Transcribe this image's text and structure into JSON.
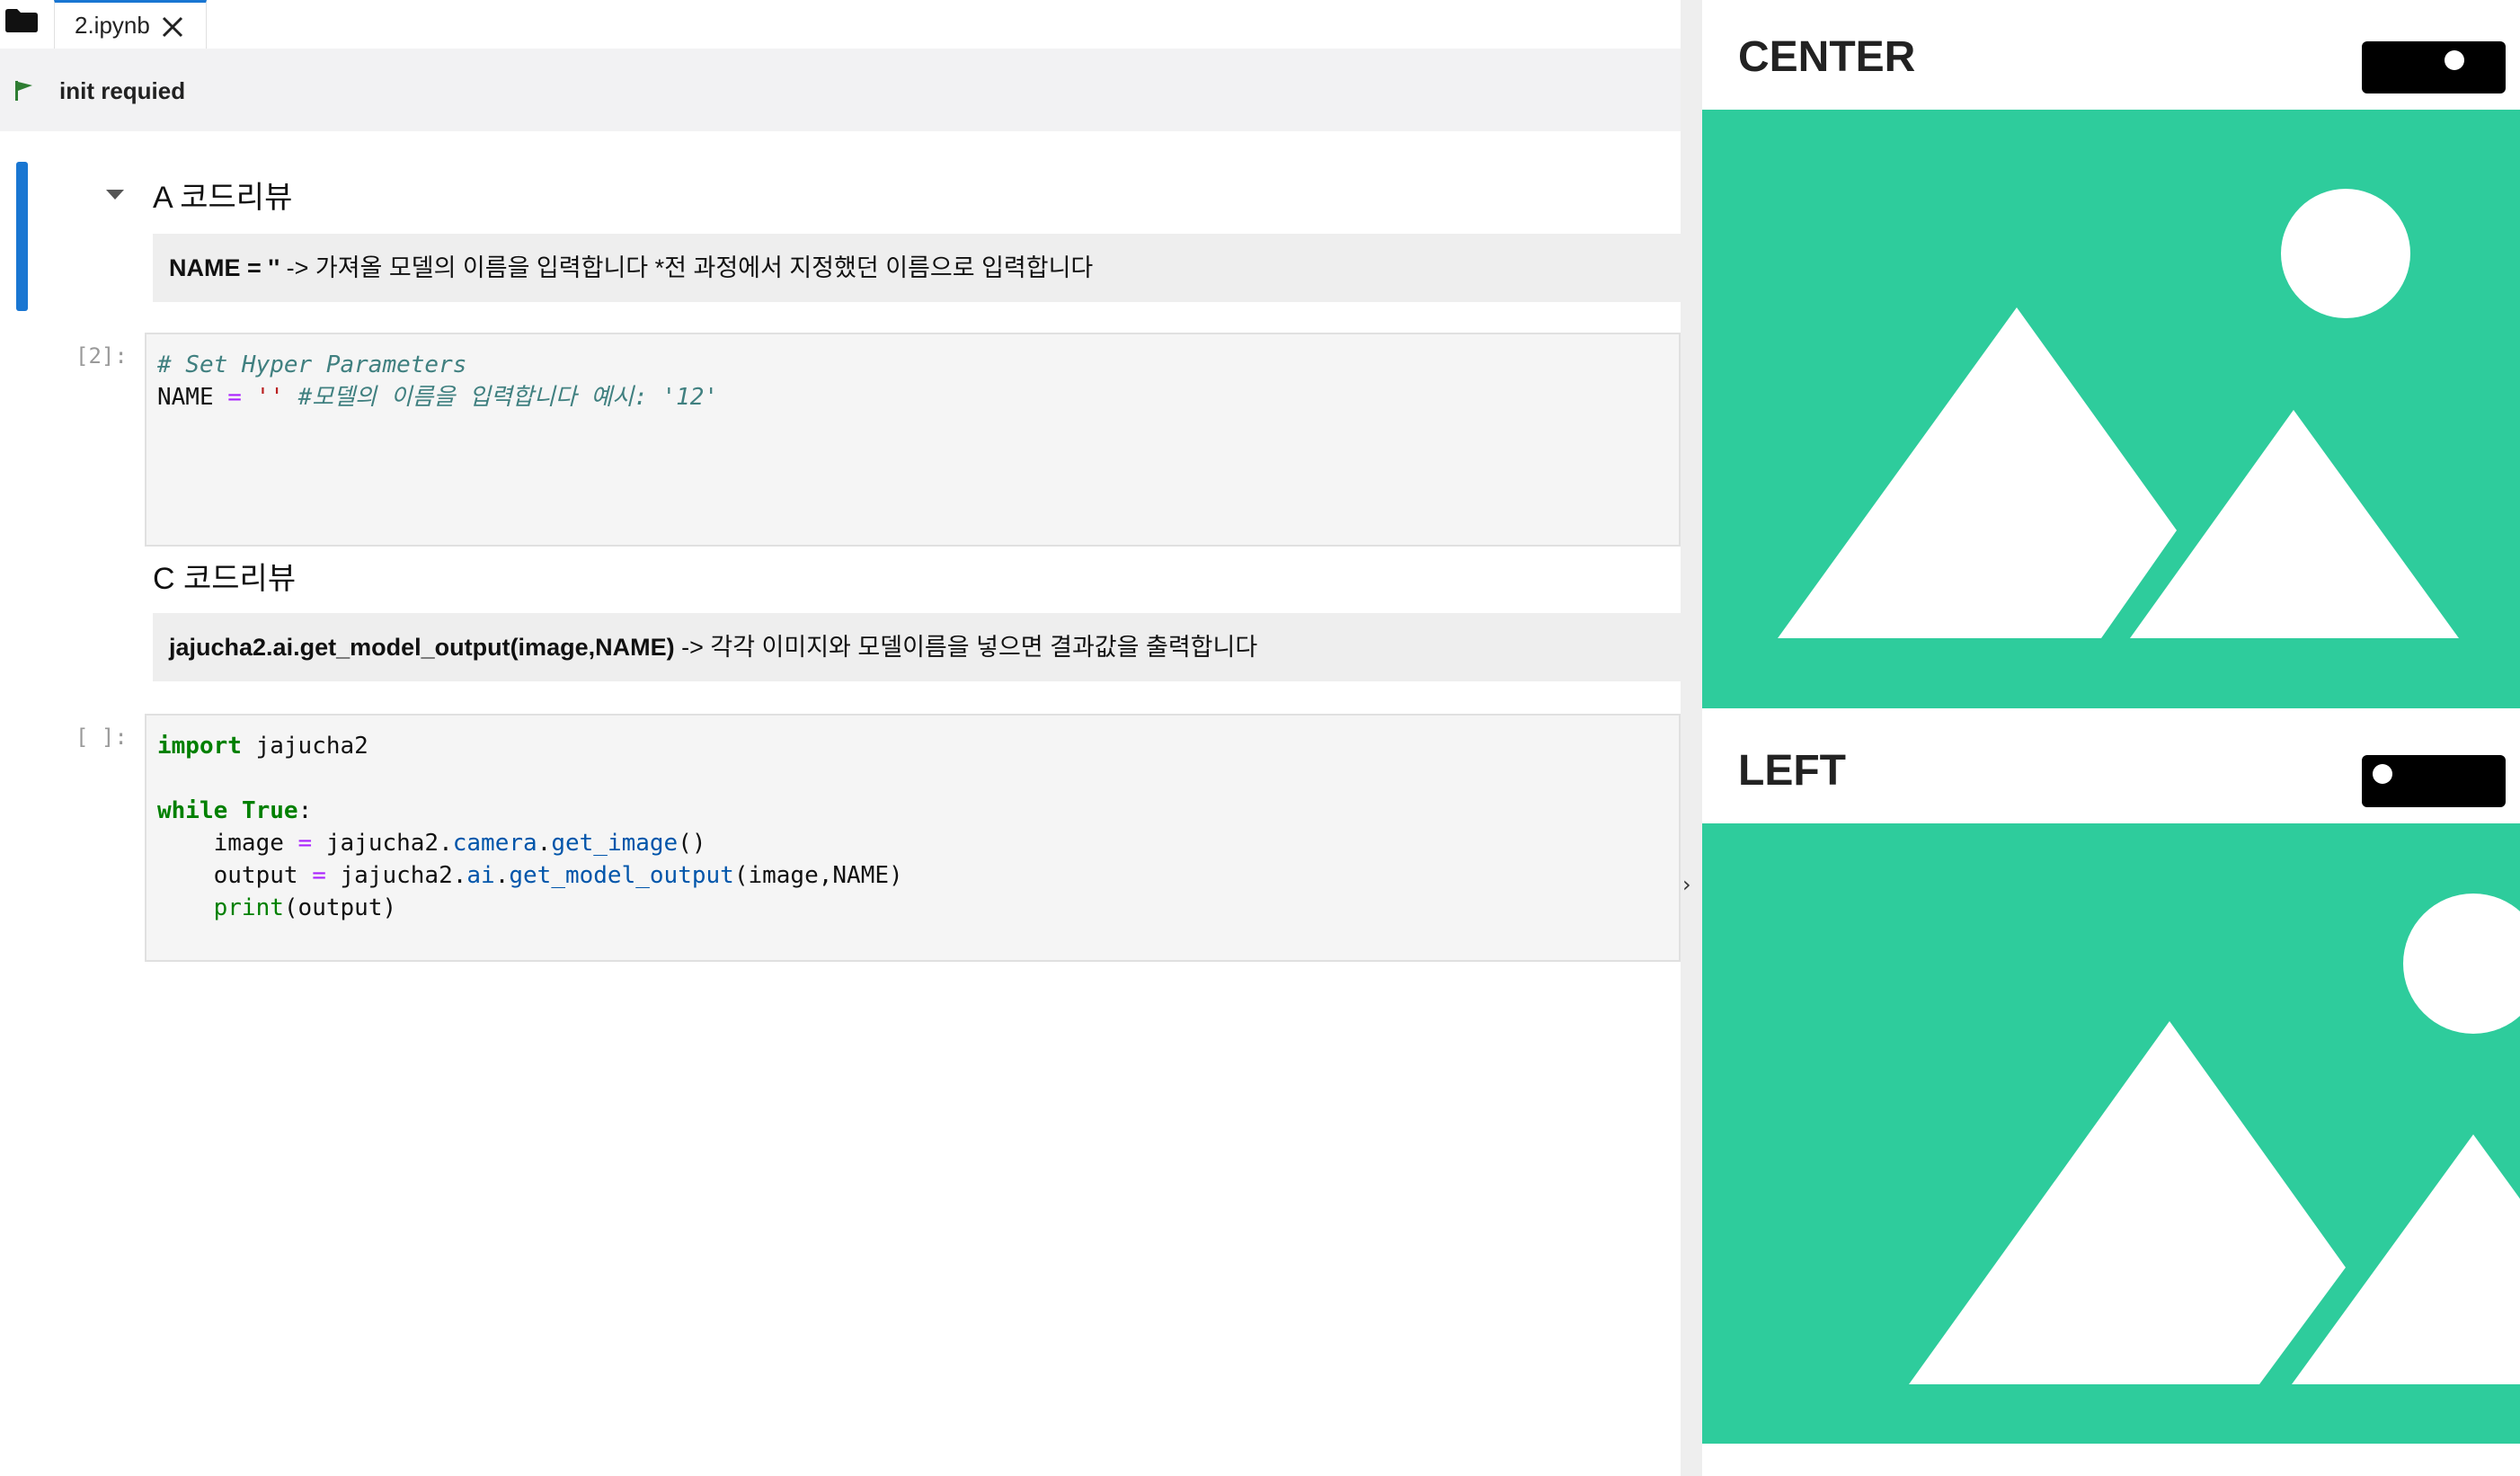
{
  "tabbar": {
    "folder_icon": "folder-icon",
    "active_tab": {
      "label": "2.ipynb",
      "close_icon": "close-icon"
    }
  },
  "toolbar": {
    "flag_icon": "flag-icon",
    "label": "init requied"
  },
  "notebook": {
    "section_a": {
      "heading": "A 코드리뷰",
      "note_bold": "NAME = ''",
      "note_text": " -> 가져올 모델의 이름을 입력합니다 *전 과정에서 지정했던 이름으로 입력합니다"
    },
    "cell_1": {
      "prompt": "[2]:",
      "line1_comment": "# Set Hyper Parameters",
      "line2_name": "NAME",
      "line2_eq": "=",
      "line2_str": "''",
      "line2_comment": "#모델의 이름을 입력합니다 예시: '12'"
    },
    "section_c": {
      "heading": "C 코드리뷰",
      "note_bold": "jajucha2.ai.get_model_output(image,NAME)",
      "note_text": " -> 각각 이미지와 모델이름을 넣으면 결과값을 출력합니다"
    },
    "cell_2": {
      "prompt": "[ ]:",
      "kw_import": "import",
      "module": " jajucha2",
      "kw_while": "while",
      "kw_true": "True",
      "colon": ":",
      "l4_var": "    image ",
      "l4_eq": "=",
      "l4_obj": " jajucha2.",
      "l4_attr": "camera",
      "l4_dot": ".",
      "l4_fn": "get_image",
      "l4_args": "()",
      "l5_var": "    output ",
      "l5_eq": "=",
      "l5_obj": " jajucha2.",
      "l5_attr": "ai",
      "l5_dot": ".",
      "l5_fn": "get_model_output",
      "l5_args": "(image,NAME)",
      "l6_indent": "    ",
      "l6_fn": "print",
      "l6_args": "(output)"
    }
  },
  "divider": {
    "arrow": "›"
  },
  "right_panel": {
    "center": {
      "title": "CENTER",
      "toggle_icon": "toggle-switch",
      "image_icon": "image-placeholder-icon"
    },
    "left": {
      "title": "LEFT",
      "toggle_icon": "toggle-switch",
      "image_icon": "image-placeholder-icon"
    }
  },
  "colors": {
    "accent": "#1976d2",
    "placeholder": "#2ecc9c",
    "toggle": "#000000",
    "flag": "#2e7d32"
  }
}
